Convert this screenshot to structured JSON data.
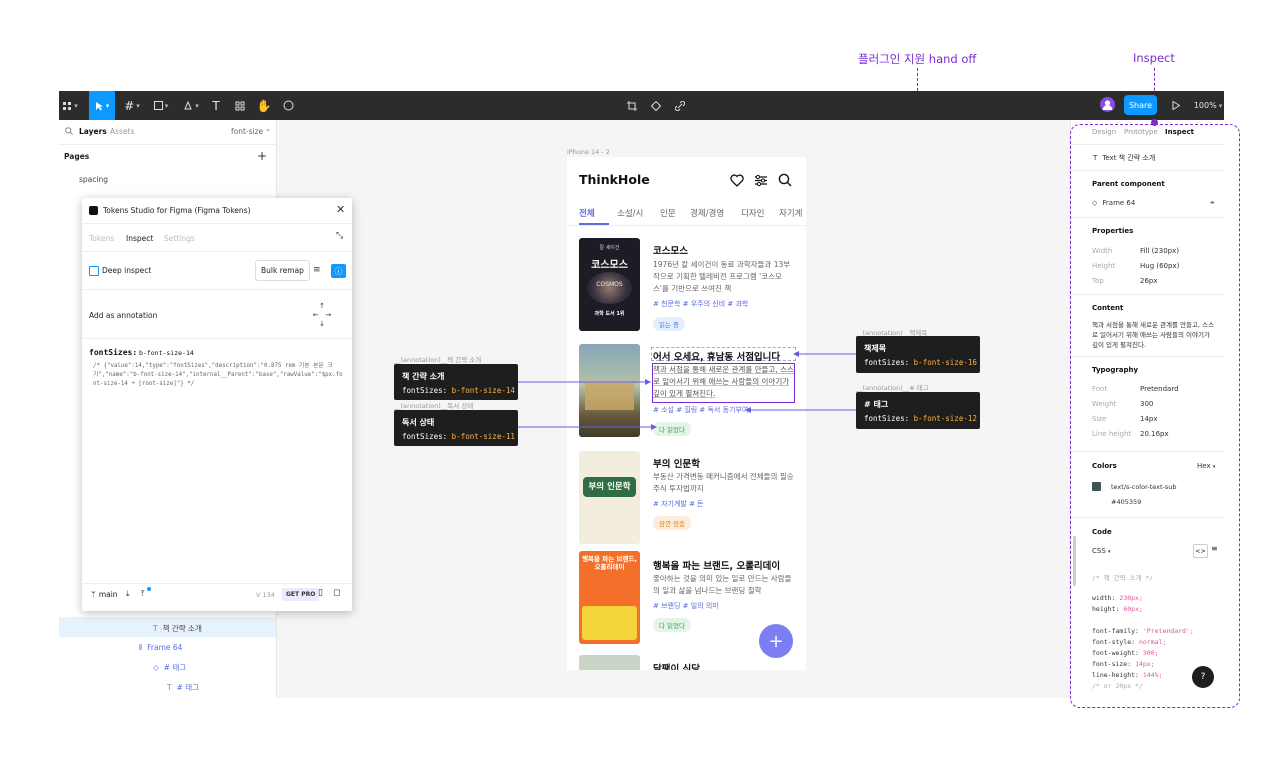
{
  "top_annotations": {
    "plugin_label": "플러그인 지원 hand off",
    "inspect_label": "Inspect"
  },
  "toolbar": {
    "share_label": "Share",
    "zoom": "100%"
  },
  "left_panel": {
    "tabs": [
      "Layers",
      "Assets"
    ],
    "search_value": "font-size",
    "pages_label": "Pages",
    "add_symbol": "+",
    "pages": [
      "spacing"
    ],
    "layers": [
      {
        "label": "책 간략 소개"
      },
      {
        "label": "Frame 64"
      },
      {
        "label": "# 태그"
      },
      {
        "label": "# 태그"
      }
    ]
  },
  "plugin": {
    "title": "Tokens Studio for Figma (Figma Tokens)",
    "tabs": [
      "Tokens",
      "Inspect",
      "Settings"
    ],
    "deep_inspect": "Deep inspect",
    "bulk_remap": "Bulk remap",
    "add_annotation": "Add as annotation",
    "token_key": "fontSizes:",
    "token_name": "b-font-size-14",
    "token_json": "/* {\"value\":14,\"type\":\"fontSizes\",\"description\":\"0.875 rem 기본 본문 크기\",\"name\":\"b-font-size-14\",\"internal__Parent\":\"base\",\"rawValue\":\"$px.font-size-14 + [root-size]\"} */",
    "branch": "main",
    "version": "V 134",
    "get_pro": "GET PRO"
  },
  "canvas": {
    "frame_label": "iPhone 14 - 2"
  },
  "phone": {
    "app_name": "ThinkHole",
    "tabs": [
      "전체",
      "소설/시",
      "인문",
      "경제/경영",
      "디자인",
      "자기계"
    ],
    "books": [
      {
        "cover_top": "칼 세이건",
        "cover_title": "코스모스",
        "cover_sub": "COSMOS",
        "cover_badge": "과학 도서 1위",
        "title": "코스모스",
        "desc": "1976년 칼 세이건이 동료 과학자들과 13부작으로 기획한 텔레비전 프로그램 '코스모스'를 기반으로 쓰여진 책",
        "tags": "# 천문학  # 우주의 신비  # 과학",
        "badge": "읽는 중"
      },
      {
        "title": "어서 오세요, 휴남동 서점입니다",
        "desc": "책과 서점을 통해 새로운 관계를 만들고, 스스로 일어서기 위해 애쓰는 사람들의 이야기가 깊이 있게 펼쳐진다.",
        "tags": "# 소설  # 힐링  # 독서 동기부여",
        "badge": "다 읽었다"
      },
      {
        "cover_title": "부의 인문학",
        "title": "부의 인문학",
        "desc": "부동산 가격변동 메커니즘에서 전체들의 필승 주식 투자법까지",
        "tags": "# 자기계발  # 돈",
        "badge": "잠깐 멈춤"
      },
      {
        "cover_title": "행복을 파는 브랜드, 오롤리데이",
        "title": "행복을 파는 브랜드, 오롤리데이",
        "desc": "좋아하는 것을 의미 있는 일로 만드는 사람들의 일과 삶을 넘나드는 브랜딩 철학",
        "tags": "# 브랜딩  # 일의 의미",
        "badge": "다 읽었다"
      },
      {
        "title": "달팽이 식당"
      }
    ],
    "fab": "+"
  },
  "annotations": {
    "left": [
      {
        "caption": "__(annotation)__책 간략 소개",
        "title": "책 간략 소개",
        "prop": "fontSizes:",
        "token": "b-font-size-14"
      },
      {
        "caption": "__(annotation)__독서 상태",
        "title": "독서 상태",
        "prop": "fontSizes:",
        "token": "b-font-size-11"
      }
    ],
    "right": [
      {
        "caption": "__(annotation)__책제목",
        "title": "책제목",
        "prop": "fontSizes:",
        "token": "b-font-size-16"
      },
      {
        "caption": "__(annotation)__# 태그",
        "title": "# 태그",
        "prop": "fontSizes:",
        "token": "b-font-size-12"
      }
    ]
  },
  "inspect": {
    "tabs": [
      "Design",
      "Prototype",
      "Inspect"
    ],
    "layer": "Text  책 간략 소개",
    "parent_component_label": "Parent component",
    "parent_component": "Frame 64",
    "properties_label": "Properties",
    "properties": [
      {
        "k": "Width",
        "v": "Fill (230px)"
      },
      {
        "k": "Height",
        "v": "Hug (60px)"
      },
      {
        "k": "Top",
        "v": "26px"
      }
    ],
    "content_label": "Content",
    "content": "책과 서점을 통해 새로운 관계를 만들고, 스스로 일어서기 위해 애쓰는 사람들의 이야기가 깊이 있게 펼쳐진다.",
    "typography_label": "Typography",
    "typography": [
      {
        "k": "Font",
        "v": "Pretendard"
      },
      {
        "k": "Weight",
        "v": "300"
      },
      {
        "k": "Size",
        "v": "14px"
      },
      {
        "k": "Line height",
        "v": "20.16px"
      }
    ],
    "colors_label": "Colors",
    "color_format": "Hex",
    "color_token": "text/s-color-text-sub",
    "color_hex": "#405359",
    "color_swatch": "#405359",
    "code_label": "Code",
    "code_lang": "CSS",
    "code_lines": [
      {
        "c": "/* 책 간략 소개 */"
      },
      {
        "k": "width:",
        "v": "230px;"
      },
      {
        "k": "height:",
        "v": "60px;"
      },
      {
        "k": "font-family:",
        "v": "'Pretendard';"
      },
      {
        "k": "font-style:",
        "v": "normal;"
      },
      {
        "k": "font-weight:",
        "v": "300;"
      },
      {
        "k": "font-size:",
        "v": "14px;"
      },
      {
        "k": "line-height:",
        "v": "144%;"
      },
      {
        "c": "/* or 20px */"
      }
    ],
    "help": "?"
  },
  "colors": {
    "accent": "#0d99ff",
    "annotation_purple": "#7a2cd6",
    "brand_blue": "#5b6be0",
    "fab": "#7b7ff2"
  }
}
